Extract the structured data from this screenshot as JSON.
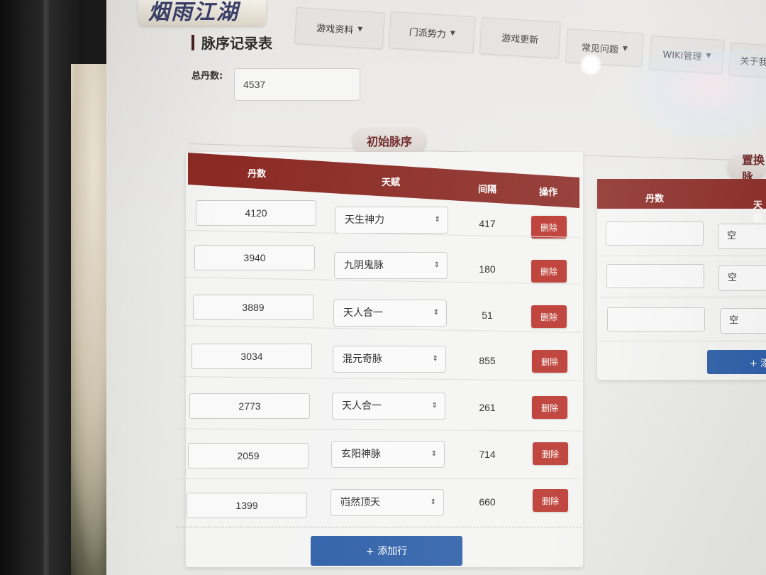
{
  "logo_text": "烟雨江湖",
  "nav": [
    {
      "label": "游戏资料",
      "dropdown": true
    },
    {
      "label": "门派势力",
      "dropdown": true
    },
    {
      "label": "游戏更新",
      "dropdown": false
    },
    {
      "label": "常见问题",
      "dropdown": true
    },
    {
      "label": "WIKI管理",
      "dropdown": true
    },
    {
      "label": "关于我",
      "dropdown": false
    }
  ],
  "page": {
    "title": "脉序记录表",
    "total_label": "总丹数:",
    "total_value": "4537"
  },
  "initial": {
    "section_title": "初始脉序",
    "headers": {
      "dan": "丹数",
      "talent": "天赋",
      "gap": "间隔",
      "action": "操作"
    },
    "rows": [
      {
        "dan": "4120",
        "talent": "天生神力",
        "gap": "417",
        "action": "删除"
      },
      {
        "dan": "3940",
        "talent": "九阴鬼脉",
        "gap": "180",
        "action": "删除"
      },
      {
        "dan": "3889",
        "talent": "天人合一",
        "gap": "51",
        "action": "删除"
      },
      {
        "dan": "3034",
        "talent": "混元奇脉",
        "gap": "855",
        "action": "删除"
      },
      {
        "dan": "2773",
        "talent": "天人合一",
        "gap": "261",
        "action": "删除"
      },
      {
        "dan": "2059",
        "talent": "玄阳神脉",
        "gap": "714",
        "action": "删除"
      },
      {
        "dan": "1399",
        "talent": "岿然顶天",
        "gap": "660",
        "action": "删除"
      }
    ],
    "add_label": "+ 添加行"
  },
  "replace": {
    "section_title": "置换脉",
    "headers": {
      "dan": "丹数",
      "talent": "天赋"
    },
    "rows": [
      {
        "dan": "",
        "talent": "空"
      },
      {
        "dan": "",
        "talent": "空"
      },
      {
        "dan": "",
        "talent": "空"
      }
    ],
    "add_label": "+ 添"
  },
  "icons": {
    "dropdown": "caret-down-icon",
    "select": "updown-arrows-icon"
  },
  "colors": {
    "header_red": "#8b2a24",
    "delete_red": "#b83028",
    "add_blue": "#2c5ea8"
  }
}
